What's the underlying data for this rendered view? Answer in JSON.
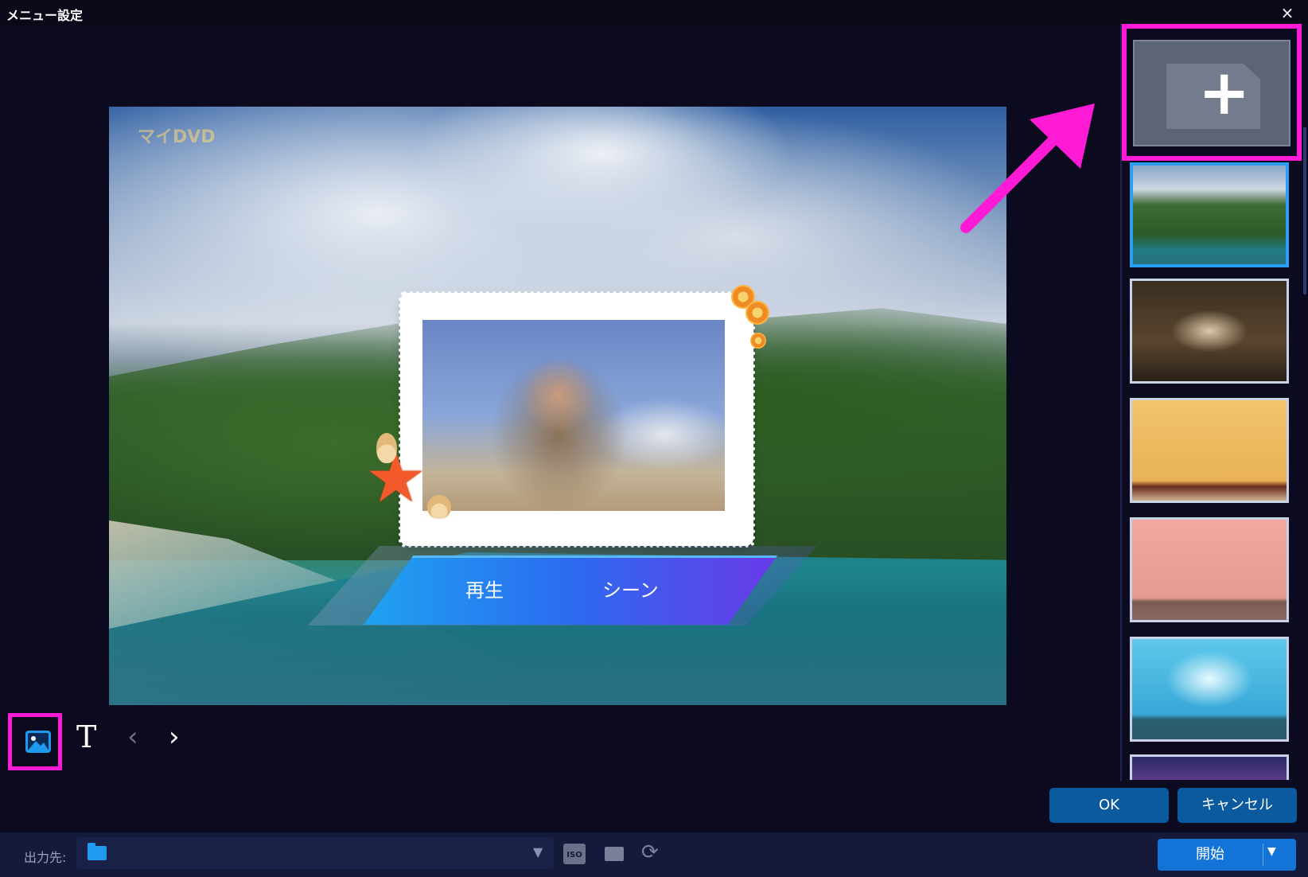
{
  "window": {
    "title": "メニュー設定",
    "close_icon": "×"
  },
  "preview": {
    "watermark": "マイDVD",
    "menu_buttons": {
      "play": "再生",
      "scene": "シーン"
    }
  },
  "tools": {
    "text_tool": "T",
    "prev": "‹",
    "next": "›"
  },
  "sidebar": {
    "add_symbol": "+"
  },
  "dialog": {
    "ok_label": "OK",
    "cancel_label": "キャンセル"
  },
  "bottom": {
    "output_label": "出力先:",
    "iso_label": "ISO",
    "refresh_symbol": "⟳",
    "start_label": "開始",
    "dropdown_symbol": "▼",
    "select_caret": "▼"
  },
  "colors": {
    "highlight": "#ff1bd6",
    "accent": "#1373d6",
    "selected_border": "#2a9df4"
  }
}
